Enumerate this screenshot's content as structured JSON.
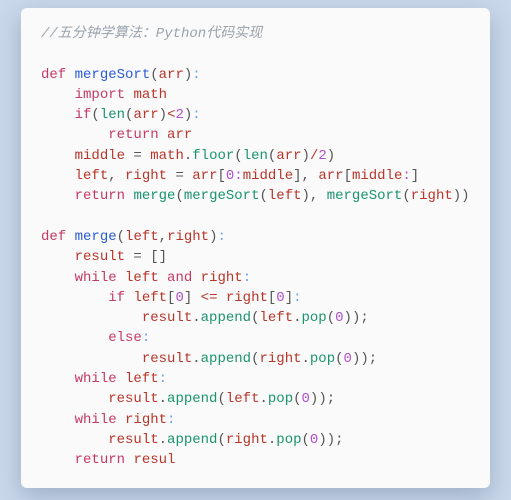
{
  "comment": "//五分钟学算法：Python代码实现",
  "t": {
    "def": "def",
    "import": "import",
    "if": "if",
    "return": "return",
    "while": "while",
    "else": "else",
    "and": "and",
    "mergeSort": "mergeSort",
    "merge": "merge",
    "arr": "arr",
    "math": "math",
    "len": "len",
    "floor": "floor",
    "middle": "middle",
    "left": "left",
    "right": "right",
    "result": "result",
    "resul": "resul",
    "append": "append",
    "pop": "pop",
    "lp": "(",
    "rp": ")",
    "lb": "[",
    "rb": "]",
    "colon": ":",
    "comma": ", ",
    "commaT": ",",
    "dot": ".",
    "eq": " = ",
    "lt": "<",
    "lte": " <= ",
    "div": "/",
    "semi": ";",
    "sp": " ",
    "n0": "0",
    "n2": "2",
    "empty": "[]"
  }
}
